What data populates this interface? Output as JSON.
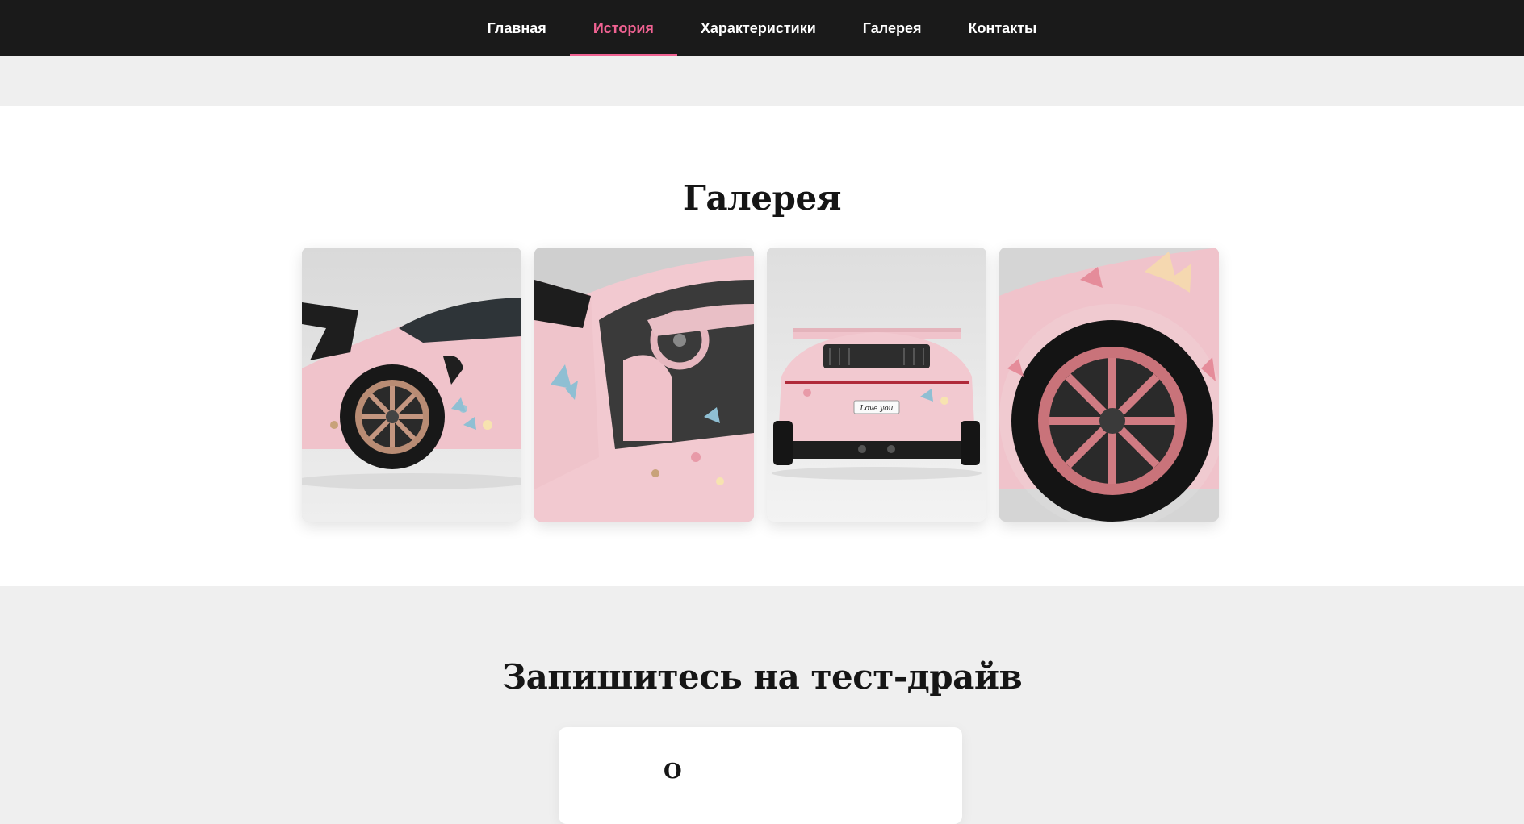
{
  "nav": {
    "items": [
      {
        "label": "Главная",
        "active": false
      },
      {
        "label": "История",
        "active": true
      },
      {
        "label": "Характеристики",
        "active": false
      },
      {
        "label": "Галерея",
        "active": false
      },
      {
        "label": "Контакты",
        "active": false
      }
    ],
    "active_color": "#f06292",
    "background": "#1a1a1a"
  },
  "gallery": {
    "title": "Галерея",
    "images": [
      {
        "name": "gallery-image-rear-side"
      },
      {
        "name": "gallery-image-open-door-interior"
      },
      {
        "name": "gallery-image-rear-view"
      },
      {
        "name": "gallery-image-wheel-closeup"
      }
    ],
    "rear_plate_text": "Love you"
  },
  "testdrive": {
    "title": "Запишитесь на тест-драйв",
    "form_first_label": "О"
  },
  "colors": {
    "accent": "#f06292",
    "car_pink": "#f2c4cc",
    "section_grey": "#efefef"
  }
}
